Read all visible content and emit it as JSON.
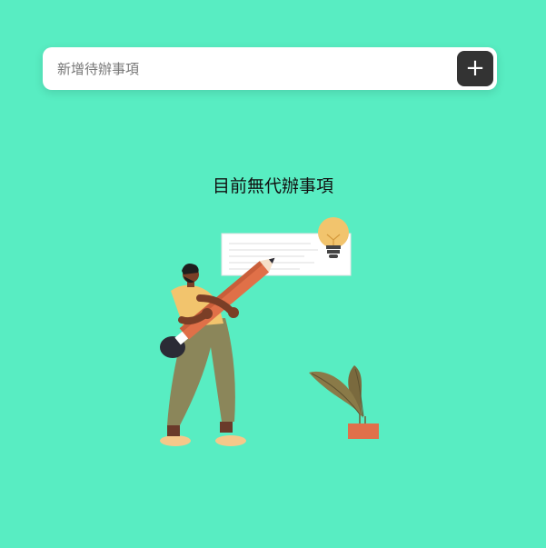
{
  "todo_form": {
    "placeholder": "新增待辦事項",
    "add_button_label": "+"
  },
  "empty_state": {
    "message": "目前無代辦事項"
  },
  "colors": {
    "background": "#58edc2",
    "button": "#333333"
  },
  "icons": {
    "add": "plus-icon",
    "illustration": "person-with-pencil-illustration"
  }
}
